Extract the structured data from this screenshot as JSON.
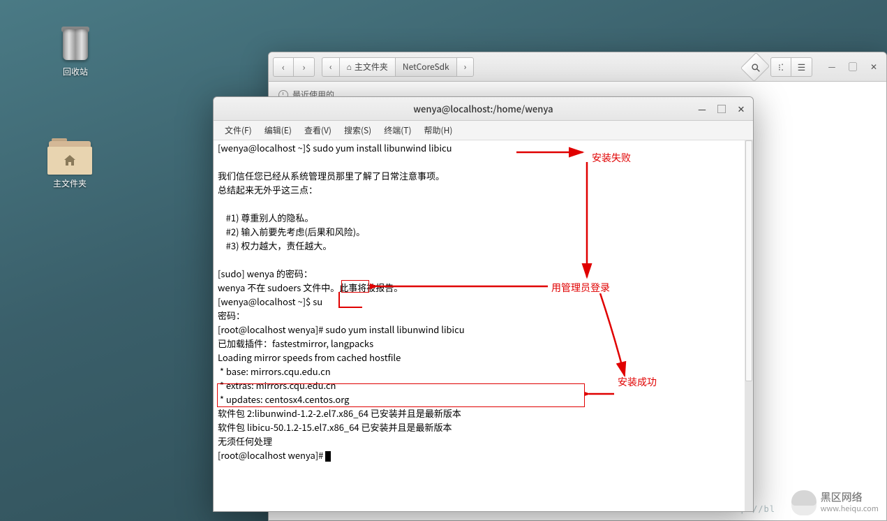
{
  "desktop": {
    "trash_label": "回收站",
    "home_label": "主文件夹"
  },
  "filemanager": {
    "nav_back": "‹",
    "nav_fwd": "›",
    "path_back": "‹",
    "home_crumb": "主文件夹",
    "folder_crumb": "NetCoreSdk",
    "path_fwd": "›",
    "search": "⚲",
    "view_icons": "⁝⁚",
    "view_list": "☰",
    "min": "—",
    "max": "▢",
    "close": "✕",
    "recent": "最近使用的"
  },
  "terminal": {
    "title": "wenya@localhost:/home/wenya",
    "menu": {
      "file": "文件(F)",
      "edit": "编辑(E)",
      "view": "查看(V)",
      "search": "搜索(S)",
      "terminal": "终端(T)",
      "help": "帮助(H)"
    },
    "controls": {
      "min": "—",
      "max": "▢",
      "close": "✕"
    },
    "lines": {
      "l1": "[wenya@localhost ~]$ sudo yum install libunwind libicu",
      "l2": "",
      "l3": "我们信任您已经从系统管理员那里了解了日常注意事项。",
      "l4": "总结起来无外乎这三点：",
      "l5": "",
      "l6": "    #1) 尊重别人的隐私。",
      "l7": "    #2) 输入前要先考虑(后果和风险)。",
      "l8": "    #3) 权力越大，责任越大。",
      "l9": "",
      "l10": "[sudo] wenya 的密码：",
      "l11": "wenya 不在 sudoers 文件中。此事将被报告。",
      "l12": "[wenya@localhost ~]$ su",
      "l13": "密码：",
      "l14": "[root@localhost wenya]# sudo yum install libunwind libicu",
      "l15": "已加载插件：fastestmirror, langpacks",
      "l16": "Loading mirror speeds from cached hostfile",
      "l17": " * base: mirrors.cqu.edu.cn",
      "l18": " * extras: mirrors.cqu.edu.cn",
      "l19": " * updates: centosx4.centos.org",
      "l20": "软件包 2:libunwind-1.2-2.el7.x86_64 已安装并且是最新版本",
      "l21": "软件包 libicu-50.1.2-15.el7.x86_64 已安装并且是最新版本",
      "l22": "无须任何处理",
      "l23": "[root@localhost wenya]# "
    }
  },
  "annotations": {
    "fail": "安装失败",
    "admin": "用管理员登录",
    "success": "安装成功"
  },
  "watermark": {
    "brand": "黑区网络",
    "url": "www.heiqu.com",
    "faint": "http://bl"
  }
}
